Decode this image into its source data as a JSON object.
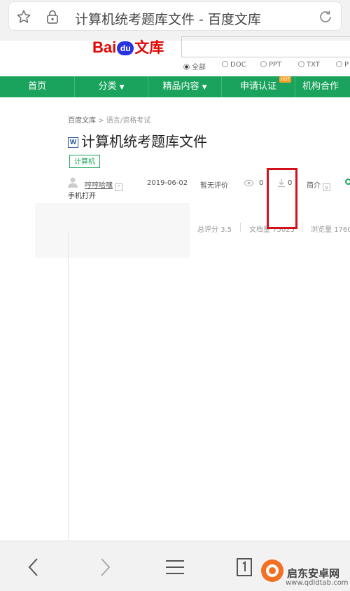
{
  "browser": {
    "url_title": "计算机统考题库文件 - 百度文库",
    "star_icon": "star-icon",
    "lock_icon": "lock-icon",
    "refresh_icon": "refresh-icon"
  },
  "header": {
    "logo": {
      "bai": "Bai",
      "du": "du",
      "wenku": "文库"
    },
    "filetypes": [
      "全部",
      "DOC",
      "PPT",
      "TXT",
      "P"
    ],
    "selected_filetype": "全部"
  },
  "nav": {
    "items": [
      "首页",
      "分类",
      "精品内容",
      "申请认证",
      "机构合作"
    ],
    "hot_badge": "HOT"
  },
  "doc": {
    "breadcrumb": {
      "root": "百度文库",
      "sep": ">",
      "path": "语言/资格考试"
    },
    "file_type_icon": "W",
    "title": "计算机统考题库文件",
    "tag": "计算机",
    "meta": {
      "author": "哼哼哈嘿",
      "date": "2019-06-02",
      "rating_text": "暂无评价",
      "views": "0",
      "downloads": "0",
      "intro_label": "简介"
    },
    "mobile_open": "手机打开",
    "stats": {
      "score": "总评分 3.5",
      "doc_count": "文档量 75025",
      "views": "浏览量 1760"
    }
  },
  "watermark": {
    "name": "启东安卓网",
    "url": "www.qdldtab.com"
  },
  "colors": {
    "nav_green": "#1aa35c",
    "highlight_red": "#d1121b",
    "logo_red": "#e10601",
    "logo_blue": "#2832e1"
  }
}
